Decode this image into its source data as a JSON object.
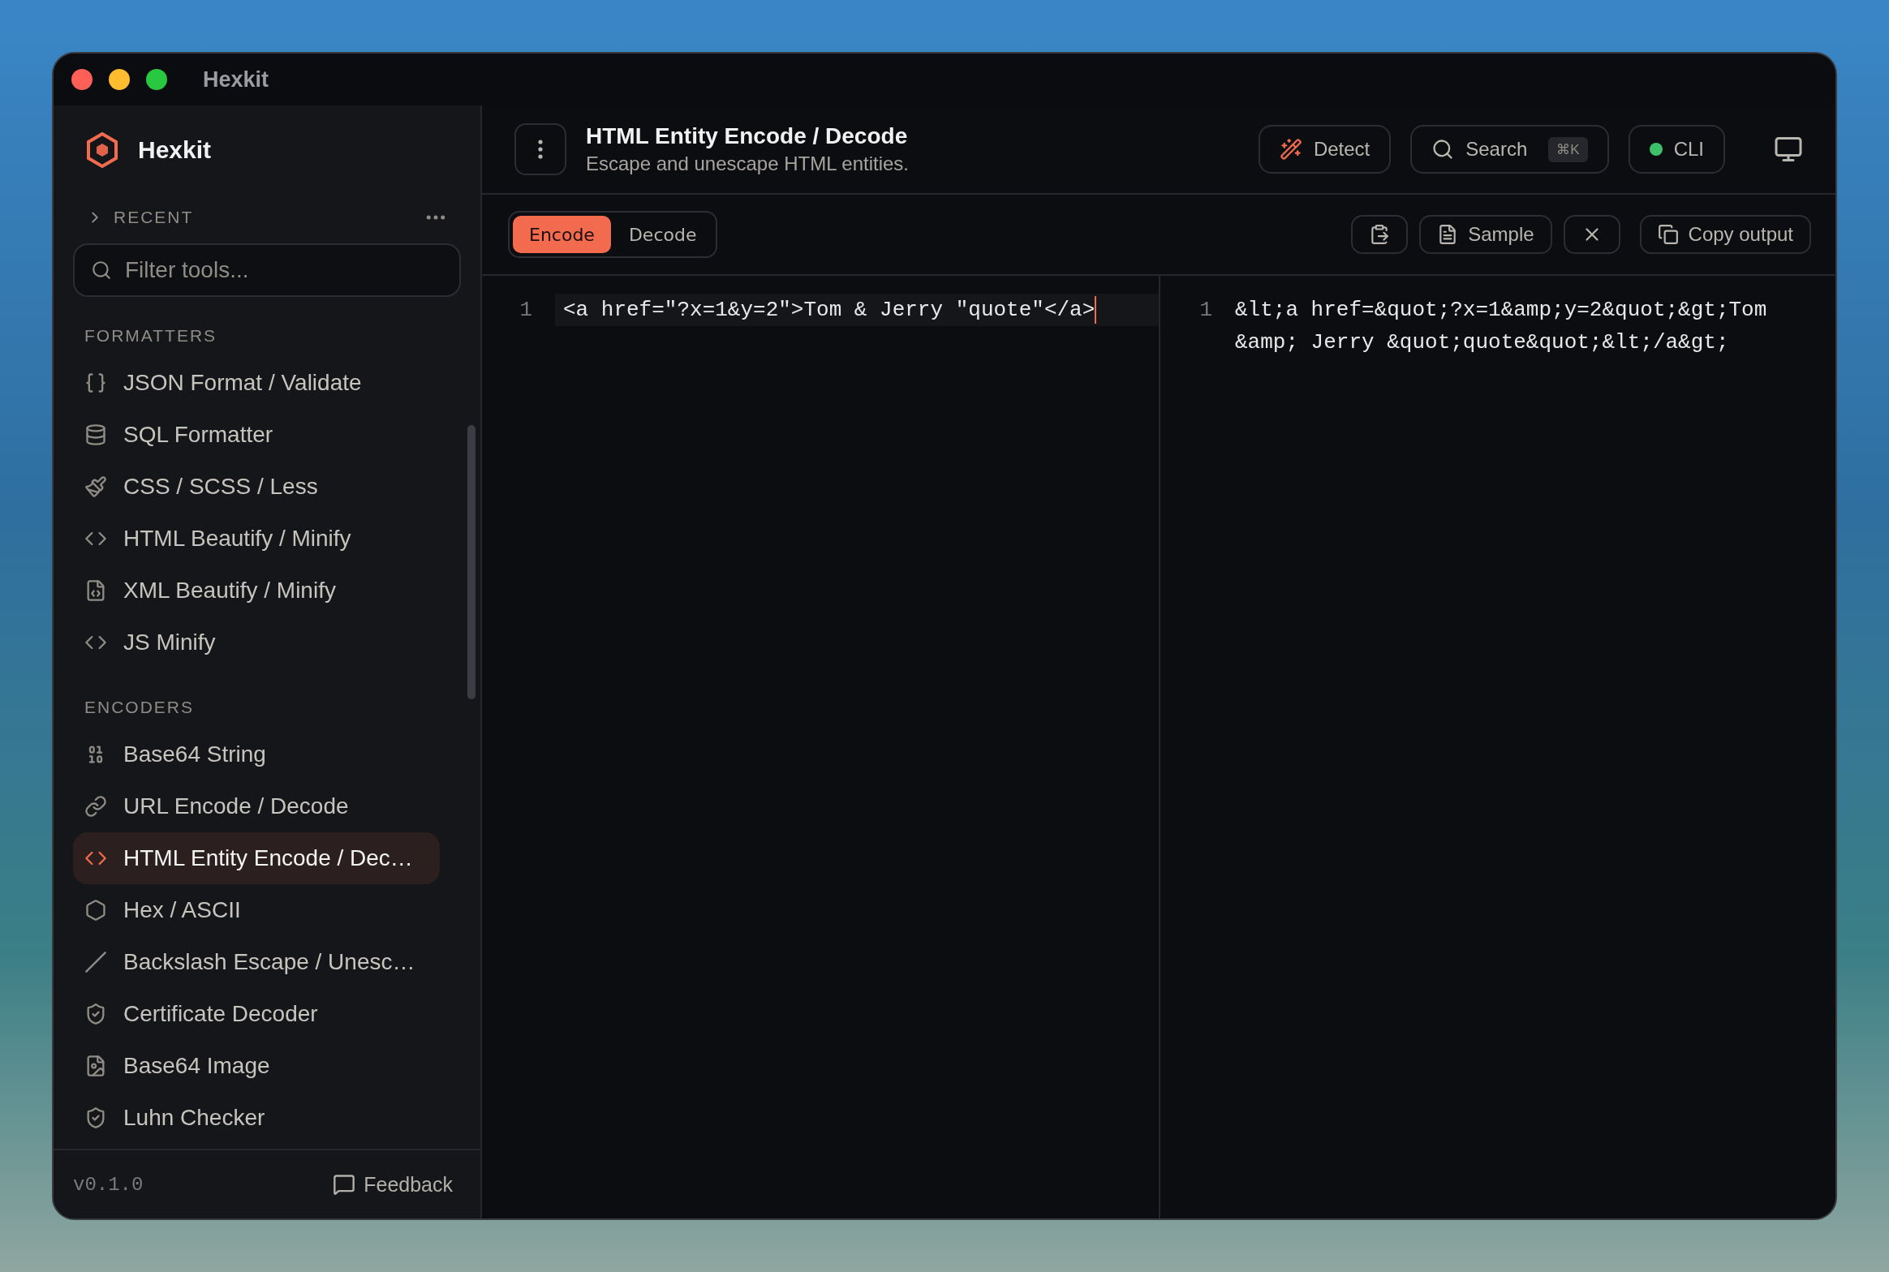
{
  "window": {
    "title": "Hexkit"
  },
  "sidebar": {
    "brand": "Hexkit",
    "recent": {
      "label": "RECENT",
      "expanded": false
    },
    "filter": {
      "placeholder": "Filter tools..."
    },
    "sections": [
      {
        "title": "FORMATTERS",
        "items": [
          {
            "label": "JSON Format / Validate",
            "selected": false
          },
          {
            "label": "SQL Formatter",
            "selected": false
          },
          {
            "label": "CSS / SCSS / Less",
            "selected": false
          },
          {
            "label": "HTML Beautify / Minify",
            "selected": false
          },
          {
            "label": "XML Beautify / Minify",
            "selected": false
          },
          {
            "label": "JS Minify",
            "selected": false
          }
        ]
      },
      {
        "title": "ENCODERS",
        "items": [
          {
            "label": "Base64 String",
            "selected": false
          },
          {
            "label": "URL Encode / Decode",
            "selected": false
          },
          {
            "label": "HTML Entity Encode / Dec…",
            "selected": true
          },
          {
            "label": "Hex / ASCII",
            "selected": false
          },
          {
            "label": "Backslash Escape / Unesc…",
            "selected": false
          },
          {
            "label": "Certificate Decoder",
            "selected": false
          },
          {
            "label": "Base64 Image",
            "selected": false
          },
          {
            "label": "Luhn Checker",
            "selected": false
          }
        ]
      }
    ],
    "version": "v0.1.0",
    "feedback": "Feedback"
  },
  "header": {
    "title": "HTML Entity Encode / Decode",
    "subtitle": "Escape and unescape HTML entities.",
    "detect": "Detect",
    "search": {
      "label": "Search",
      "shortcut": "⌘K"
    },
    "cli": {
      "label": "CLI",
      "online": true
    }
  },
  "toolbar": {
    "tabs": [
      {
        "label": "Encode",
        "selected": true
      },
      {
        "label": "Decode",
        "selected": false
      }
    ],
    "sample": "Sample",
    "copy": "Copy output"
  },
  "input": {
    "line_number": "1",
    "text": "<a href=\"?x=1&y=2\">Tom & Jerry \"quote\"</a>"
  },
  "output": {
    "line_number": "1",
    "text": "&lt;a href=&quot;?x=1&amp;y=2&quot;&gt;Tom &amp; Jerry &quot;quote&quot;&lt;/a&gt;"
  }
}
